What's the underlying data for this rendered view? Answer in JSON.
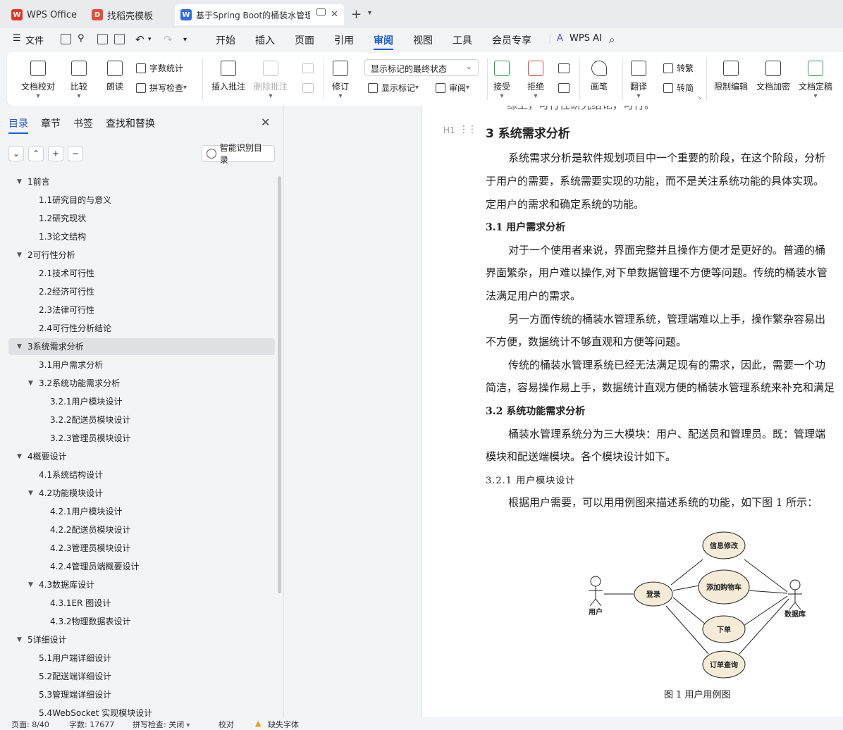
{
  "tabs": [
    {
      "label": "WPS Office",
      "icon": "wps-logo-icon"
    },
    {
      "label": "找稻壳模板",
      "icon": "docer-icon"
    },
    {
      "label": "基于Spring Boot的桶装水管理",
      "icon": "word-doc-icon"
    }
  ],
  "menu": {
    "file": "文件",
    "items": [
      "开始",
      "插入",
      "页面",
      "引用",
      "审阅",
      "视图",
      "工具",
      "会员专享"
    ],
    "active": "审阅",
    "ai": "WPS AI"
  },
  "ribbon": {
    "proofread": "文档校对",
    "compare": "比较",
    "read_aloud": "朗读",
    "word_count": "字数统计",
    "spell_check": "拼写检查",
    "insert_comment": "插入批注",
    "delete_comment": "删除批注",
    "track_changes": "修订",
    "markup_state": "显示标记的最终状态",
    "show_markup": "显示标记",
    "review": "审阅",
    "accept": "接受",
    "reject": "拒绝",
    "pen": "画笔",
    "translate": "翻译",
    "to_traditional": "转繁",
    "to_simplified": "转简",
    "restrict_edit": "限制编辑",
    "encrypt": "文档加密",
    "finalize": "文档定稿"
  },
  "sidebar": {
    "tabs": [
      "目录",
      "章节",
      "书签",
      "查找和替换"
    ],
    "smart_toc": "智能识别目录",
    "toc": [
      {
        "label": "1前言",
        "level": 1,
        "toggle": true
      },
      {
        "label": "1.1研究目的与意义",
        "level": 2
      },
      {
        "label": "1.2研究现状",
        "level": 2
      },
      {
        "label": "1.3论文结构",
        "level": 2
      },
      {
        "label": "2可行性分析",
        "level": 1,
        "toggle": true
      },
      {
        "label": "2.1技术可行性",
        "level": 2
      },
      {
        "label": "2.2经济可行性",
        "level": 2
      },
      {
        "label": "2.3法律可行性",
        "level": 2
      },
      {
        "label": "2.4可行性分析结论",
        "level": 2
      },
      {
        "label": "3系统需求分析",
        "level": 1,
        "toggle": true,
        "selected": true
      },
      {
        "label": "3.1用户需求分析",
        "level": 2
      },
      {
        "label": "3.2系统功能需求分析",
        "level": 2,
        "toggle": true
      },
      {
        "label": "3.2.1用户模块设计",
        "level": 3
      },
      {
        "label": "3.2.2配送员模块设计",
        "level": 3
      },
      {
        "label": "3.2.3管理员模块设计",
        "level": 3
      },
      {
        "label": "4概要设计",
        "level": 1,
        "toggle": true
      },
      {
        "label": "4.1系统结构设计",
        "level": 2
      },
      {
        "label": "4.2功能模块设计",
        "level": 2,
        "toggle": true
      },
      {
        "label": "4.2.1用户模块设计",
        "level": 3
      },
      {
        "label": "4.2.2配送员模块设计",
        "level": 3
      },
      {
        "label": "4.2.3管理员模块设计",
        "level": 3
      },
      {
        "label": "4.2.4管理员端概要设计",
        "level": 3
      },
      {
        "label": "4.3数据库设计",
        "level": 2,
        "toggle": true
      },
      {
        "label": "4.3.1ER 图设计",
        "level": 3
      },
      {
        "label": "4.3.2物理数据表设计",
        "level": 3
      },
      {
        "label": "5详细设计",
        "level": 1,
        "toggle": true
      },
      {
        "label": "5.1用户端详细设计",
        "level": 2
      },
      {
        "label": "5.2配送端详细设计",
        "level": 2
      },
      {
        "label": "5.3管理端详细设计",
        "level": 2
      },
      {
        "label": "5.4WebSocket 实现模块设计",
        "level": 2
      }
    ]
  },
  "document": {
    "top_fragment": "综上，可行性研究结论，可行。",
    "heading_marker": "H1",
    "h1": "3  系统需求分析",
    "p1": [
      "系统需求分析是软件规划项目中一个重要的阶段，在这个阶段，分析",
      "于用户的需要，系统需要实现的功能，而不是关注系统功能的具体实现。",
      "定用户的需求和确定系统的功能。"
    ],
    "h2a": "3.1  用户需求分析",
    "p2": [
      "对于一个使用者来说，界面完整并且操作方便才是更好的。普通的桶",
      "界面繁杂，用户难以操作,对下单数据管理不方便等问题。传统的桶装水管",
      "法满足用户的需求。"
    ],
    "p3": [
      "另一方面传统的桶装水管理系统，管理端难以上手，操作繁杂容易出",
      "不方便，数据统计不够直观和方便等问题。"
    ],
    "p4": [
      "传统的桶装水管理系统已经无法满足现有的需求，因此，需要一个功",
      "简洁，容易操作易上手，数据统计直观方便的桶装水管理系统来补充和满足"
    ],
    "h2b": "3.2  系统功能需求分析",
    "p5": [
      "桶装水管理系统分为三大模块：用户、配送员和管理员。既：管理端",
      "模块和配送端模块。各个模块设计如下。"
    ],
    "h3": "3.2.1  用户模块设计",
    "p6": "根据用户需要，可以用用例图来描述系统的功能，如下图 1 所示：",
    "diagram": {
      "actor_left": "用户",
      "actor_right": "数据库",
      "login": "登录",
      "use_cases": [
        "信息修改",
        "添加购物车",
        "下单",
        "订单查询"
      ]
    },
    "caption": "图 1  用户用例图"
  },
  "status": {
    "page": "页面: 8/40",
    "words": "字数: 17677",
    "spell": "拼写检查: 关闭",
    "proof": "校对",
    "missing_font": "缺失字体"
  }
}
